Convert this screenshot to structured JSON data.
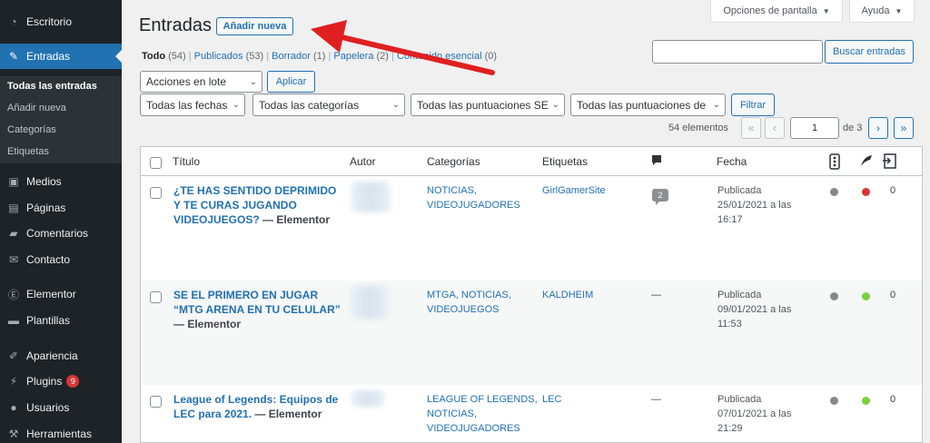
{
  "sidebar": {
    "items": [
      {
        "label": "Escritorio",
        "icon": "dashboard-icon"
      },
      {
        "label": "Entradas",
        "icon": "pin-icon"
      },
      {
        "label": "Medios",
        "icon": "media-icon"
      },
      {
        "label": "Páginas",
        "icon": "pages-icon"
      },
      {
        "label": "Comentarios",
        "icon": "comments-icon"
      },
      {
        "label": "Contacto",
        "icon": "mail-icon"
      },
      {
        "label": "Elementor",
        "icon": "elementor-icon"
      },
      {
        "label": "Plantillas",
        "icon": "folder-icon"
      },
      {
        "label": "Apariencia",
        "icon": "brush-icon"
      },
      {
        "label": "Plugins",
        "icon": "plugin-icon",
        "badge": "9"
      },
      {
        "label": "Usuarios",
        "icon": "user-icon"
      },
      {
        "label": "Herramientas",
        "icon": "wrench-icon"
      }
    ],
    "submenu": [
      "Todas las entradas",
      "Añadir nueva",
      "Categorías",
      "Etiquetas"
    ]
  },
  "header": {
    "title": "Entradas",
    "add_new": "Añadir nueva",
    "screen_options": "Opciones de pantalla",
    "help": "Ayuda"
  },
  "filters": {
    "views": [
      {
        "label": "Todo",
        "count": "(54)"
      },
      {
        "label": "Publicados",
        "count": "(53)"
      },
      {
        "label": "Borrador",
        "count": "(1)"
      },
      {
        "label": "Papelera",
        "count": "(2)"
      },
      {
        "label": "Contenido esencial",
        "count": "(0)"
      }
    ],
    "search_button": "Buscar entradas",
    "bulk_action": "Acciones en lote",
    "apply": "Aplicar",
    "dates": "Todas las fechas",
    "categories": "Todas las categorías",
    "ratings1": "Todas las puntuaciones SE",
    "ratings2": "Todas las puntuaciones de",
    "filter_button": "Filtrar"
  },
  "pagination": {
    "count": "54 elementos",
    "first": "«",
    "prev": "‹",
    "current": "1",
    "of": "de 3",
    "next": "›",
    "last": "»"
  },
  "table": {
    "headers": {
      "title": "Título",
      "author": "Autor",
      "categories": "Categorías",
      "tags": "Etiquetas",
      "date": "Fecha"
    },
    "rows": [
      {
        "title_lines": [
          "¿TE HAS SENTIDO DEPRIMIDO",
          "Y TE CURAS JUGANDO",
          "VIDEOJUEGOS?"
        ],
        "suffix": " — Elementor",
        "categories": [
          "NOTICIAS,",
          "VIDEOJUGADORES"
        ],
        "tags": "GirlGamerSite",
        "comments": "2",
        "date": [
          "Publicada",
          "25/01/2021 a las",
          "16:17"
        ],
        "seo_color": "#dc3232",
        "count": "0"
      },
      {
        "title_lines": [
          "SE EL PRIMERO EN JUGAR",
          "“MTG ARENA EN TU CELULAR”"
        ],
        "suffix_line": "— Elementor",
        "categories": [
          "MTGA, NOTICIAS,",
          "VIDEOJUEGOS"
        ],
        "tags": "KALDHEIM",
        "comments": "—",
        "date": [
          "Publicada",
          "09/01/2021 a las",
          "11:53"
        ],
        "seo_color": "#7ad03a",
        "count": "0"
      },
      {
        "title_lines": [
          "League of Legends: Equipos de",
          "LEC para 2021."
        ],
        "suffix": " — Elementor",
        "categories": [
          "LEAGUE OF LEGENDS,",
          "NOTICIAS,",
          "VIDEOJUGADORES"
        ],
        "tags": "LEC",
        "comments": "—",
        "date": [
          "Publicada",
          "07/01/2021 a las",
          "21:29"
        ],
        "seo_color": "#7ad03a",
        "count": "0"
      }
    ]
  },
  "annotation": {
    "color": "#e02020"
  }
}
